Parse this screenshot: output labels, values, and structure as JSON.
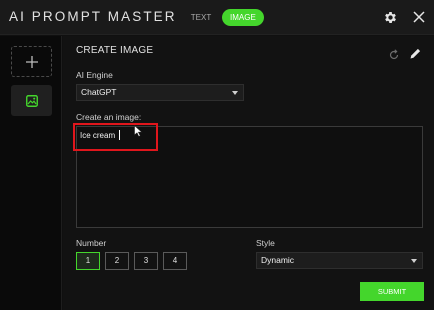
{
  "app": {
    "title": "AI PROMPT MASTER"
  },
  "mode_toggle": {
    "text_label": "TEXT",
    "image_label": "IMAGE",
    "active": "IMAGE"
  },
  "header_icons": {
    "settings": "gear-icon",
    "close": "close-icon"
  },
  "sidebar": {
    "new_icon": "plus-icon",
    "image_icon": "image-icon"
  },
  "main": {
    "section_title": "CREATE IMAGE",
    "actions": {
      "reset": "refresh-icon",
      "edit": "pencil-icon"
    },
    "engine": {
      "label": "AI Engine",
      "value": "ChatGPT"
    },
    "prompt": {
      "label": "Create an image:",
      "value": "Ice cream"
    },
    "number": {
      "label": "Number",
      "options": [
        "1",
        "2",
        "3",
        "4"
      ],
      "selected": "1"
    },
    "style": {
      "label": "Style",
      "value": "Dynamic"
    },
    "submit_label": "SUBMIT"
  },
  "colors": {
    "accent": "#44d62c",
    "highlight": "#e0161c",
    "background": "#101010"
  }
}
